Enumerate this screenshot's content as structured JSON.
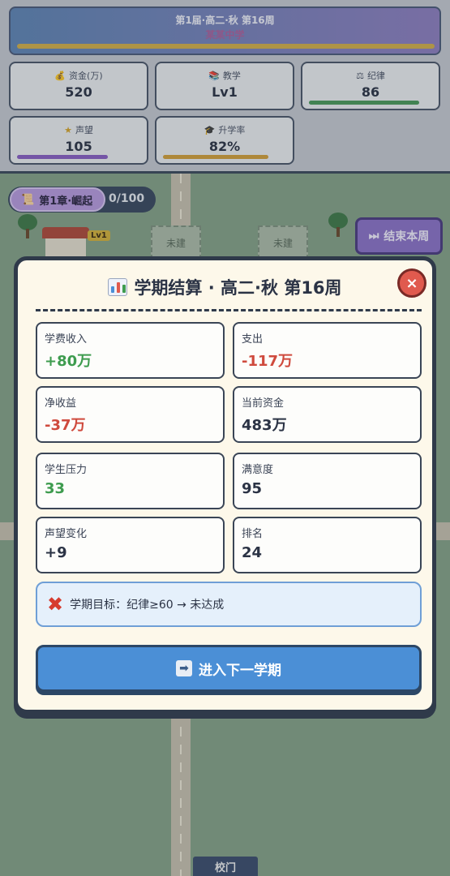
{
  "hud": {
    "banner_title": "第1届·高二·秋 第16周",
    "banner_subtitle": "某某中学",
    "stats": [
      {
        "icon": "money-bag-icon",
        "glyph": "💰",
        "label": "资金(万)",
        "value": "520"
      },
      {
        "icon": "books-icon",
        "glyph": "📚",
        "label": "教学",
        "value": "Lv1"
      },
      {
        "icon": "scale-icon",
        "glyph": "⚖",
        "label": "纪律",
        "value": "86",
        "bar_fraction": 0.86,
        "bar_color": "#4a9a5a"
      },
      {
        "icon": "star-icon",
        "glyph": "★",
        "label": "声望",
        "value": "105",
        "bar_color": "#8a5fc4"
      },
      {
        "icon": "graduation-cap-icon",
        "glyph": "🎓",
        "label": "升学率",
        "value": "82%",
        "bar_fraction": 0.82,
        "bar_color": "#d4a03a"
      }
    ]
  },
  "chapter": {
    "label": "第1章·崛起",
    "progress": "0/100"
  },
  "map": {
    "plot_label": "未建",
    "school_level": "Lv1",
    "gate_label": "校门"
  },
  "end_week_button": {
    "label": "结束本周",
    "icon": "fast-forward-icon"
  },
  "modal": {
    "title": "学期结算 · 高二·秋 第16周",
    "close_glyph": "×",
    "cards": [
      {
        "label": "学费收入",
        "value": "+80万",
        "tone": "pos"
      },
      {
        "label": "支出",
        "value": "-117万",
        "tone": "neg"
      },
      {
        "label": "净收益",
        "value": "-37万",
        "tone": "neg"
      },
      {
        "label": "当前资金",
        "value": "483万",
        "tone": "neu"
      },
      {
        "label": "学生压力",
        "value": "33",
        "tone": "pos"
      },
      {
        "label": "满意度",
        "value": "95",
        "tone": "neu"
      },
      {
        "label": "声望变化",
        "value": "+9",
        "tone": "neu"
      },
      {
        "label": "排名",
        "value": "24",
        "tone": "neu"
      }
    ],
    "goal": {
      "icon": "cross-mark-icon",
      "glyph": "✖",
      "text": "学期目标：纪律≥60 → 未达成"
    },
    "next_button": {
      "label": "进入下一学期",
      "icon": "right-arrow-icon",
      "glyph": "➡"
    }
  },
  "colors": {
    "positive": "#3e9c4f",
    "negative": "#cf4a3d",
    "modal_bg": "#fdf8ea",
    "button_blue": "#4b8fd6",
    "close_red": "#e05a4e"
  }
}
